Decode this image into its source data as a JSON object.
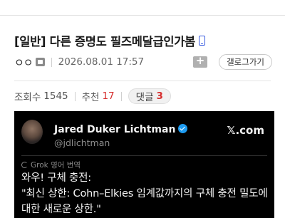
{
  "post": {
    "title": "[일반] 다른 증명도 필즈메달급인가봄",
    "author_nick": "ㅇㅇ",
    "date": "2026.08.01 17:57",
    "gallery_button": "갤로그가기"
  },
  "stats": {
    "views_label": "조회수",
    "views": "1545",
    "recommend_label": "추천",
    "recommend": "17",
    "comments_label": "댓글",
    "comments": "3"
  },
  "tweet": {
    "author_name": "Jared Duker Lichtman",
    "handle": "@jdlichtman",
    "source": "𝕏.com",
    "translation_note": "Grok 영어 번역",
    "lines": [
      "와우! 구체 충전:",
      "\"최신 상한: Cohn–Elkies 임계값까지의 구체 충전 밀도에",
      "대한 새로운 상한.\""
    ]
  },
  "colors": {
    "accent_blue": "#3b5de0",
    "count_red": "#d62e2e",
    "tweet_bg": "#000000",
    "verified_blue": "#1d9bf0"
  },
  "icons": [
    "mobile-icon",
    "nick-icon",
    "scrap-icon",
    "avatar",
    "verified-icon",
    "refresh-icon"
  ]
}
